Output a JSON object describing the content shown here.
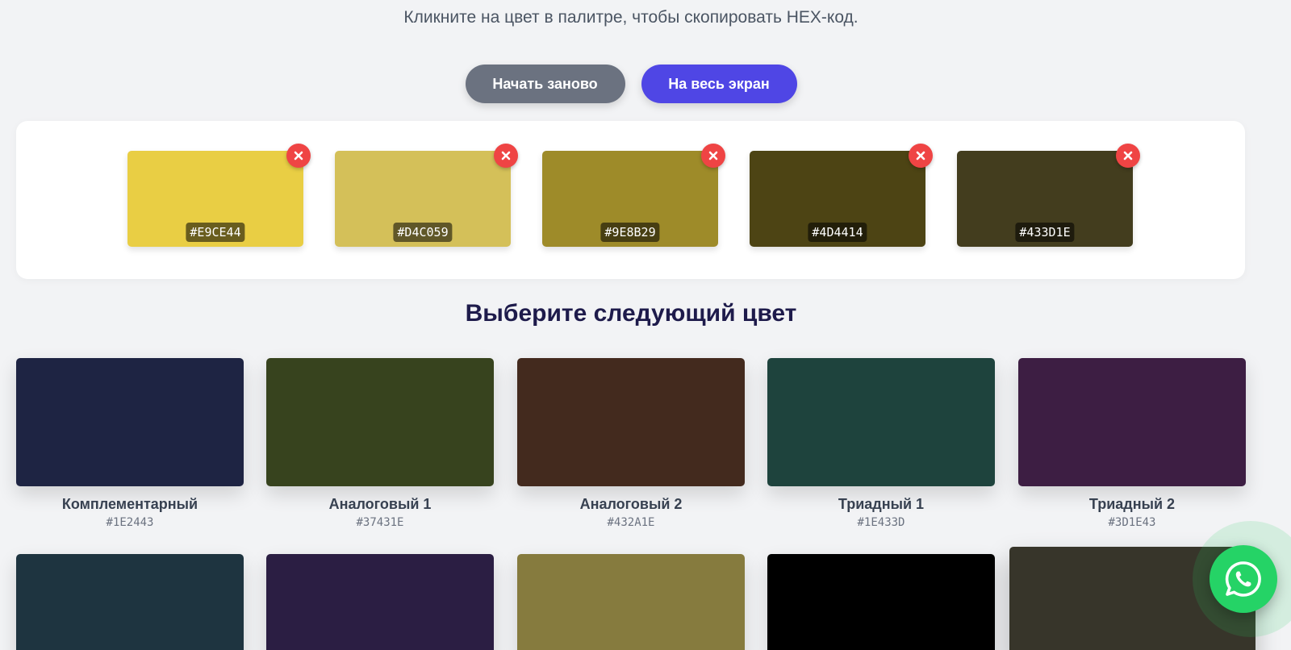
{
  "hint": "Кликните на цвет в палитре, чтобы скопировать HEX-код.",
  "actions": {
    "restart_label": "Начать заново",
    "fullscreen_label": "На весь экран"
  },
  "palette": [
    {
      "hex": "#E9CE44",
      "color": "#E9CE44"
    },
    {
      "hex": "#D4C059",
      "color": "#D4C059"
    },
    {
      "hex": "#9E8B29",
      "color": "#9E8B29"
    },
    {
      "hex": "#4D4414",
      "color": "#4D4414"
    },
    {
      "hex": "#433D1E",
      "color": "#433D1E"
    }
  ],
  "remove_icon": "close-icon",
  "section_title": "Выберите следующий цвет",
  "suggestions": [
    {
      "name": "Комплементарный",
      "hex": "#1E2443",
      "color": "#1E2443"
    },
    {
      "name": "Аналоговый 1",
      "hex": "#37431E",
      "color": "#37431E"
    },
    {
      "name": "Аналоговый 2",
      "hex": "#432A1E",
      "color": "#432A1E"
    },
    {
      "name": "Триадный 1",
      "hex": "#1E433D",
      "color": "#1E433D"
    },
    {
      "name": "Триадный 2",
      "hex": "#3D1E43",
      "color": "#3D1E43"
    }
  ],
  "suggestions_row2": [
    {
      "color": "#1E3440"
    },
    {
      "color": "#2B1E43"
    },
    {
      "color": "#867B3E"
    },
    {
      "color": "#000000"
    },
    {
      "color": "#37352A"
    }
  ],
  "chat_widget": {
    "icon": "whatsapp-icon",
    "color": "#25D366"
  }
}
